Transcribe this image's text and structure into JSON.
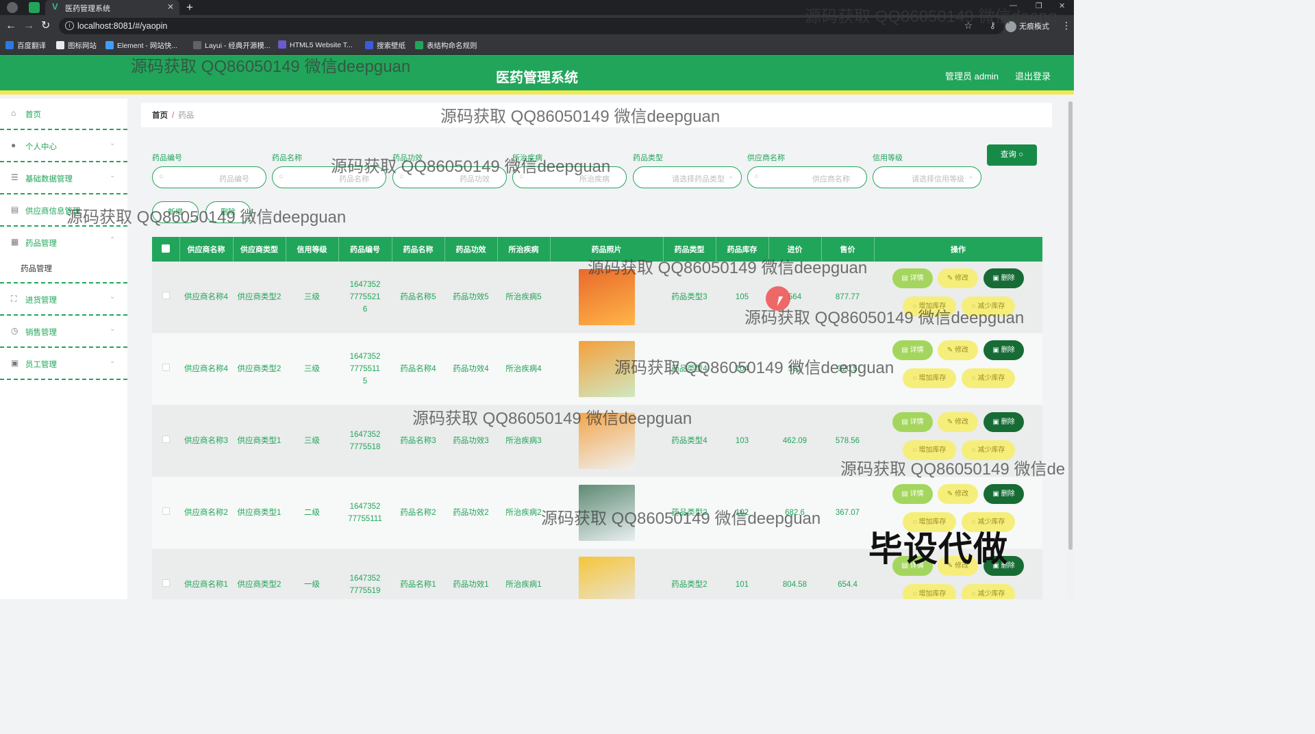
{
  "browser": {
    "tab_title": "医药管理系统",
    "url": "localhost:8081/#/yaopin",
    "incognito_label": "无痕模式",
    "bookmarks": [
      "百度翻译",
      "图标网站",
      "Element - 网站快...",
      "Layui - 经典开源模...",
      "HTML5 Website T...",
      "搜索壁纸",
      "表结构命名规则"
    ]
  },
  "header": {
    "title": "医药管理系统",
    "user": "管理员 admin",
    "logout": "退出登录"
  },
  "sidebar": {
    "items": [
      {
        "label": "首页",
        "icon": "home-icon"
      },
      {
        "label": "个人中心",
        "icon": "user-icon"
      },
      {
        "label": "基础数据管理",
        "icon": "list-icon"
      },
      {
        "label": "供应商信息管理",
        "icon": "document-icon"
      },
      {
        "label": "药品管理",
        "icon": "box-icon"
      },
      {
        "label": "进货管理",
        "icon": "fullscreen-icon"
      },
      {
        "label": "销售管理",
        "icon": "clock-icon"
      },
      {
        "label": "员工管理",
        "icon": "delete-icon"
      }
    ],
    "submenu": "药品管理"
  },
  "breadcrumb": {
    "home": "首页",
    "sep": "/",
    "current": "药品"
  },
  "search": {
    "fields": [
      {
        "label": "药品编号",
        "placeholder": "药品编号"
      },
      {
        "label": "药品名称",
        "placeholder": "药品名称"
      },
      {
        "label": "药品功效",
        "placeholder": "药品功效"
      },
      {
        "label": "所治疾病",
        "placeholder": "所治疾病"
      },
      {
        "label": "药品类型",
        "placeholder": "请选择药品类型"
      },
      {
        "label": "供应商名称",
        "placeholder": "供应商名称"
      },
      {
        "label": "信用等级",
        "placeholder": "请选择信用等级"
      }
    ],
    "query_button": "查询"
  },
  "actions": {
    "add": "新增",
    "delete": "删除"
  },
  "table": {
    "headers": [
      "供应商名称",
      "供应商类型",
      "信用等级",
      "药品编号",
      "药品名称",
      "药品功效",
      "所治疾病",
      "药品照片",
      "药品类型",
      "药品库存",
      "进价",
      "售价",
      "操作"
    ],
    "rows": [
      {
        "supplier": "供应商名称4",
        "supplier_type": "供应商类型2",
        "credit": "三级",
        "code": "164735277755216",
        "name": "药品名称5",
        "effect": "药品功效5",
        "disease": "所治疾病5",
        "type": "药品类型3",
        "stock": "105",
        "purchase": "564",
        "price": "877.77",
        "img_color": "#e86a2c",
        "img_color2": "#ffb547"
      },
      {
        "supplier": "供应商名称4",
        "supplier_type": "供应商类型2",
        "credit": "三级",
        "code": "16473527775511 5",
        "name": "药品名称4",
        "effect": "药品功效4",
        "disease": "所治疾病4",
        "type": "药品类型4",
        "stock": "104",
        "purchase": "351",
        "price": "320.5",
        "img_color": "#f4a03c",
        "img_color2": "#cfe8c2"
      },
      {
        "supplier": "供应商名称3",
        "supplier_type": "供应商类型1",
        "credit": "三级",
        "code": "16473527775518",
        "name": "药品名称3",
        "effect": "药品功效3",
        "disease": "所治疾病3",
        "type": "药品类型4",
        "stock": "103",
        "purchase": "462.09",
        "price": "578.56",
        "img_color": "#f2a64c",
        "img_color2": "#f0f0f0"
      },
      {
        "supplier": "供应商名称2",
        "supplier_type": "供应商类型1",
        "credit": "二级",
        "code": "164735277755111",
        "name": "药品名称2",
        "effect": "药品功效2",
        "disease": "所治疾病2",
        "type": "药品类型2",
        "stock": "102",
        "purchase": "682.6",
        "price": "367.07",
        "img_color": "#5f8b74",
        "img_color2": "#e8eef0"
      },
      {
        "supplier": "供应商名称1",
        "supplier_type": "供应商类型2",
        "credit": "一级",
        "code": "16473527775519",
        "name": "药品名称1",
        "effect": "药品功效1",
        "disease": "所治疾病1",
        "type": "药品类型2",
        "stock": "101",
        "purchase": "804.58",
        "price": "654.4",
        "img_color": "#f5c63a",
        "img_color2": "#e8e8e8"
      }
    ],
    "op_labels": {
      "detail": "详情",
      "edit": "修改",
      "delete": "删除",
      "add_stock": "增加库存",
      "sub_stock": "减少库存"
    }
  },
  "watermarks": {
    "text": "源码获取 QQ86050149 微信deepguan",
    "text_partial_top": "源码获取 QQ86050149 微信deepg",
    "text_partial_right": "源码获取 QQ86050149 微信de",
    "big": "毕设代做"
  },
  "colors": {
    "primary": "#21a55a",
    "accent_yellow": "#f1e94e",
    "dark_green": "#166c34"
  }
}
